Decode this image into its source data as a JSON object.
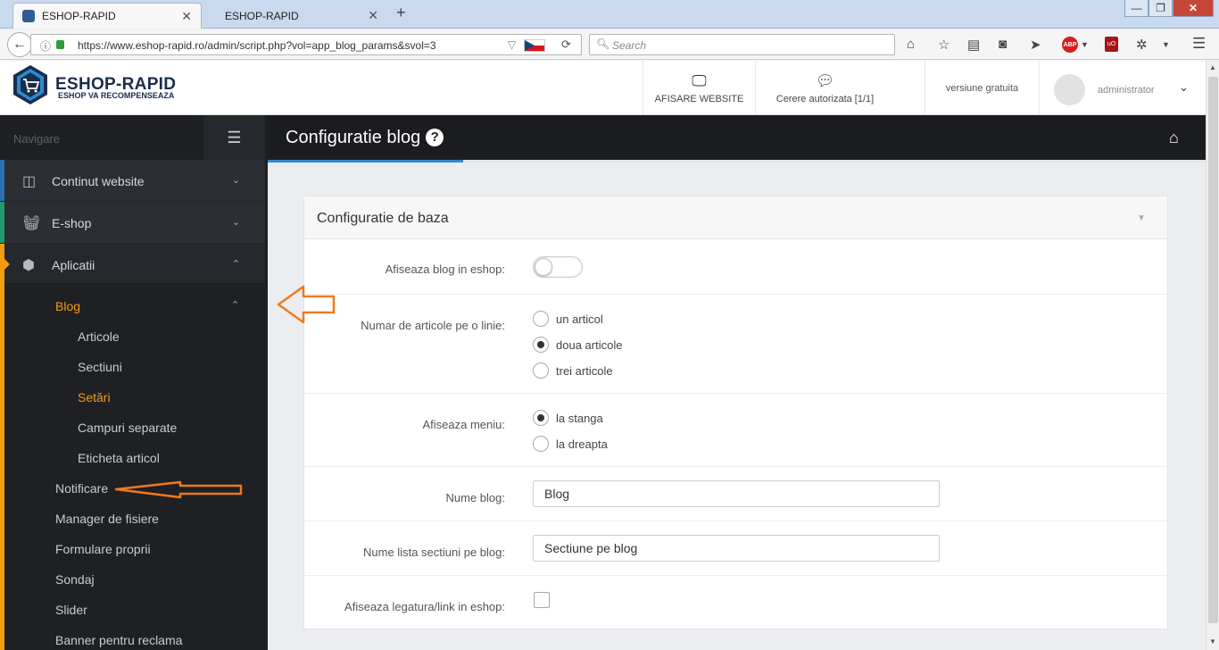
{
  "browser": {
    "tabs": [
      {
        "label": "ESHOP-RAPID",
        "active": true
      },
      {
        "label": "ESHOP-RAPID",
        "active": false
      }
    ],
    "url": "https://www.eshop-rapid.ro/admin/script.php?vol=app_blog_params&svol=3",
    "search_placeholder": "Search",
    "icons": [
      "back-icon",
      "info-icon",
      "lock-icon",
      "reload-icon",
      "home-icon",
      "star-icon",
      "reader-icon",
      "pocket-icon",
      "send-icon",
      "adblock-icon",
      "ublock-icon",
      "menu-icon"
    ],
    "abp_label": "ABP",
    "ublock_label": "uO"
  },
  "header": {
    "logo_title": "ESHOP-RAPID",
    "logo_subtitle": "ESHOP VA RECOMPENSEAZA",
    "website_label": "AFISARE WEBSITE",
    "requests_label": "Cerere autorizata [1/1]",
    "version_label": "versiune gratuita",
    "admin_name": "administrator"
  },
  "sidebar": {
    "nav_label": "Navigare",
    "menu": [
      {
        "label": "Continut website",
        "icon": "columns-icon",
        "accent": "#2a6fb0"
      },
      {
        "label": "E-shop",
        "icon": "basket-icon",
        "accent": "#1f9a6a"
      },
      {
        "label": "Aplicatii",
        "icon": "cubes-icon",
        "accent": "#f39c12"
      }
    ],
    "blog_label": "Blog",
    "blog_items": [
      "Articole",
      "Sectiuni",
      "Setări",
      "Campuri separate",
      "Eticheta articol"
    ],
    "other_items": [
      "Notificare",
      "Manager de fisiere",
      "Formulare proprii",
      "Sondaj",
      "Slider",
      "Banner pentru reclama"
    ]
  },
  "page": {
    "title": "Configuratie blog",
    "panel_title": "Configuratie de baza",
    "fields": {
      "show_blog": {
        "label": "Afiseaza blog in eshop:",
        "enabled": false
      },
      "articles_per_row": {
        "label": "Numar de articole pe o linie:",
        "options": [
          "un articol",
          "doua articole",
          "trei articole"
        ],
        "selected": "doua articole"
      },
      "menu_position": {
        "label": "Afiseaza meniu:",
        "options": [
          "la stanga",
          "la dreapta"
        ],
        "selected": "la stanga"
      },
      "blog_name": {
        "label": "Nume blog:",
        "value": "Blog"
      },
      "sections_name": {
        "label": "Nume lista sectiuni pe blog:",
        "value": "Sectiune pe blog"
      },
      "show_link": {
        "label": "Afiseaza legatura/link in eshop:",
        "checked": false
      }
    }
  },
  "colors": {
    "accent_orange": "#f39c12",
    "accent_blue": "#2d8ad0",
    "sidebar_bg": "#2b2e33",
    "annotation_arrow": "#f07a1c"
  }
}
